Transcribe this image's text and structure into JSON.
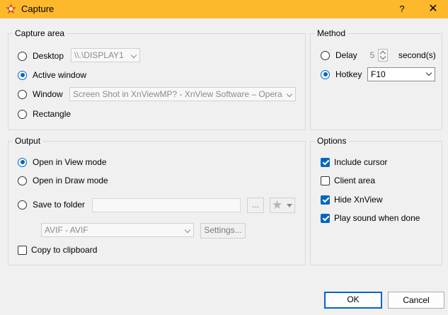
{
  "window": {
    "title": "Capture",
    "help_label": "?",
    "close_label": "✕"
  },
  "capture_area": {
    "legend": "Capture area",
    "desktop_label": "Desktop",
    "desktop_display": "\\\\.\\DISPLAY1",
    "active_window_label": "Active window",
    "window_label": "Window",
    "window_value": "Screen Shot in XnViewMP? - XnView Software – Opera",
    "rectangle_label": "Rectangle",
    "selected": "Active window"
  },
  "method": {
    "legend": "Method",
    "delay_label": "Delay",
    "delay_value": "5",
    "delay_unit": "second(s)",
    "hotkey_label": "Hotkey",
    "hotkey_value": "F10",
    "selected": "Hotkey"
  },
  "output": {
    "legend": "Output",
    "view_mode_label": "Open in View mode",
    "draw_mode_label": "Open in Draw mode",
    "save_folder_label": "Save to folder",
    "folder_value": "",
    "browse_label": "...",
    "format_value": "AVIF - AVIF",
    "settings_label": "Settings...",
    "clipboard_label": "Copy to clipboard",
    "selected": "Open in View mode",
    "clipboard_checked": false
  },
  "options": {
    "legend": "Options",
    "items": [
      {
        "label": "Include cursor",
        "checked": true
      },
      {
        "label": "Client area",
        "checked": false
      },
      {
        "label": "Hide XnView",
        "checked": true
      },
      {
        "label": "Play sound when done",
        "checked": true
      }
    ]
  },
  "footer": {
    "ok_label": "OK",
    "cancel_label": "Cancel"
  },
  "colors": {
    "titlebar": "#fdb82c",
    "accent": "#0067c0",
    "background": "#f0f0f0"
  }
}
